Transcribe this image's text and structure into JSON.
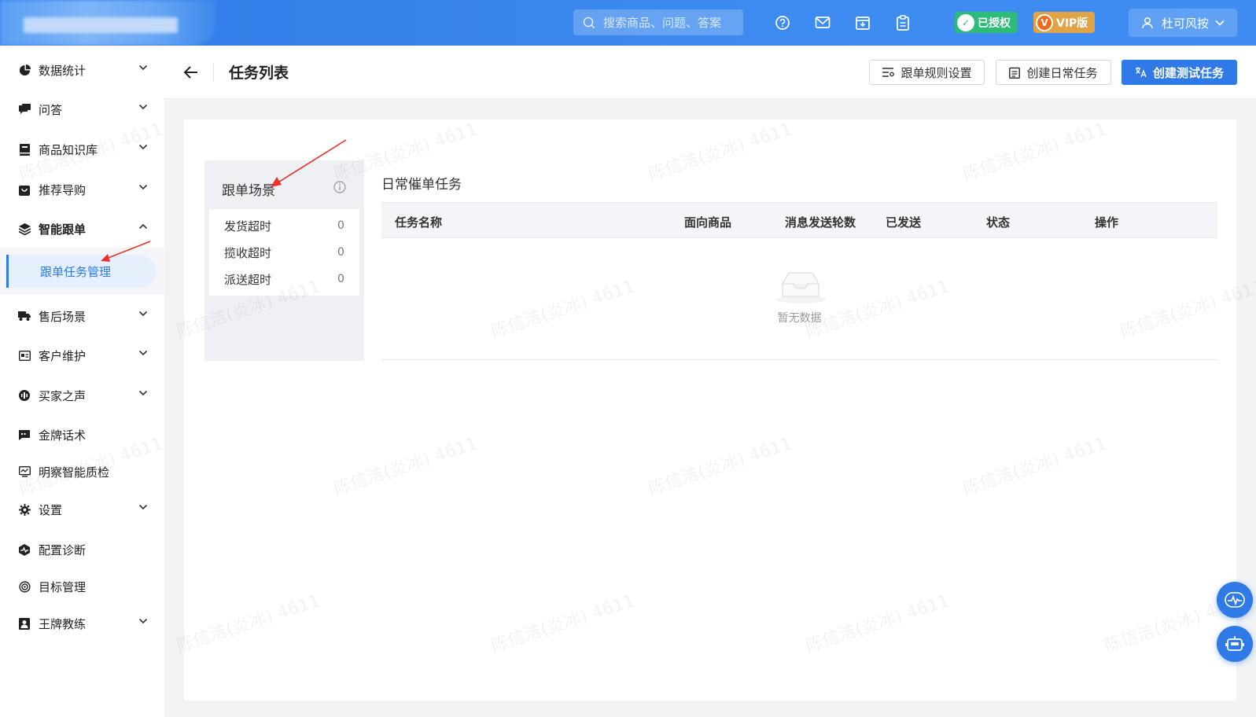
{
  "topbar": {
    "search_placeholder": "搜索商品、问题、答案",
    "icons": [
      "help-icon",
      "mail-icon",
      "inbox-icon",
      "clipboard-icon"
    ],
    "authorized_label": "已授权",
    "vip_label": "VIP版",
    "username": "杜可风按"
  },
  "sidebar": {
    "items": [
      {
        "label": "数据统计",
        "icon": "pie-chart-icon"
      },
      {
        "label": "问答",
        "icon": "chat-icon"
      },
      {
        "label": "商品知识库",
        "icon": "book-icon"
      },
      {
        "label": "推荐导购",
        "icon": "bag-icon"
      },
      {
        "label": "智能跟单",
        "icon": "layers-icon"
      },
      {
        "label": "售后场景",
        "icon": "truck-icon"
      },
      {
        "label": "客户维护",
        "icon": "id-card-icon"
      },
      {
        "label": "买家之声",
        "icon": "voice-icon"
      },
      {
        "label": "金牌话术",
        "icon": "speech-icon"
      },
      {
        "label": "明察智能质检",
        "icon": "monitor-icon"
      },
      {
        "label": "设置",
        "icon": "gear-icon"
      },
      {
        "label": "配置诊断",
        "icon": "diagnosis-icon"
      },
      {
        "label": "目标管理",
        "icon": "target-icon"
      },
      {
        "label": "王牌教练",
        "icon": "coach-icon"
      }
    ],
    "active_sub": "跟单任务管理"
  },
  "header": {
    "title": "任务列表",
    "btn_rules": "跟单规则设置",
    "btn_daily": "创建日常任务",
    "btn_test": "创建测试任务"
  },
  "scene": {
    "title": "跟单场景",
    "rows": [
      {
        "label": "发货超时",
        "count": "0"
      },
      {
        "label": "揽收超时",
        "count": "0"
      },
      {
        "label": "派送超时",
        "count": "0"
      }
    ]
  },
  "tasks": {
    "title": "日常催单任务",
    "columns": [
      "任务名称",
      "面向商品",
      "消息发送轮数",
      "已发送",
      "状态",
      "操作"
    ],
    "empty_text": "暂无数据"
  },
  "watermark": "陈信洁(炎冰) 4611",
  "colors": {
    "primary": "#2f7ae6",
    "auth": "#2cbc78",
    "vip": "#e0a346",
    "arrow": "#e8322b"
  }
}
